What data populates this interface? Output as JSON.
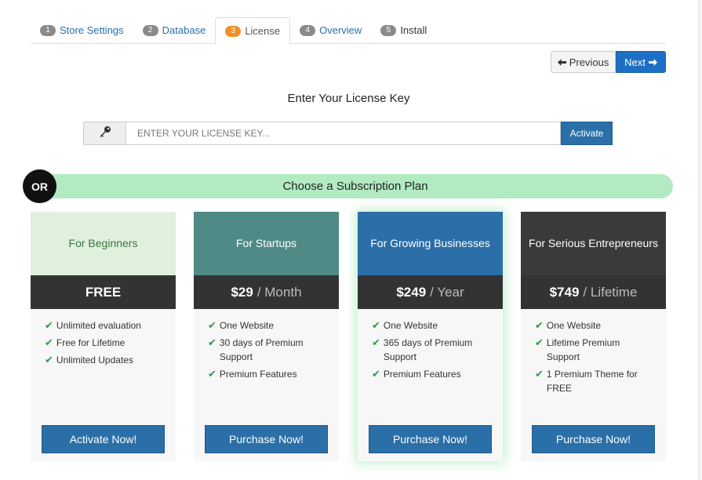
{
  "tabs": [
    {
      "num": "1",
      "label": "Store Settings"
    },
    {
      "num": "2",
      "label": "Database"
    },
    {
      "num": "3",
      "label": "License"
    },
    {
      "num": "4",
      "label": "Overview"
    },
    {
      "num": "5",
      "label": "Install"
    }
  ],
  "pager": {
    "previous_label": "Previous",
    "next_label": "Next"
  },
  "license": {
    "title": "Enter Your License Key",
    "placeholder": "ENTER YOUR LICENSE KEY...",
    "value": "",
    "activate_label": "Activate"
  },
  "or_label": "OR",
  "subscription_title": "Choose a Subscription Plan",
  "plans": [
    {
      "title": "For Beginners",
      "price": "FREE",
      "period": "",
      "features": [
        "Unlimited evaluation",
        "Free for Lifetime",
        "Unlimited Updates"
      ],
      "button": "Activate Now!",
      "header_color": "#dff0dd",
      "header_text_color": "#3c763d"
    },
    {
      "title": "For Startups",
      "price": "$29",
      "period": "/ Month",
      "features": [
        "One Website",
        "30 days of Premium Support",
        "Premium Features"
      ],
      "button": "Purchase Now!",
      "header_color": "#4f8a87",
      "header_text_color": "#ffffff"
    },
    {
      "title": "For Growing Businesses",
      "price": "$249",
      "period": "/ Year",
      "features": [
        "One Website",
        "365 days of Premium Support",
        "Premium Features"
      ],
      "button": "Purchase Now!",
      "header_color": "#2b6ea8",
      "header_text_color": "#ffffff"
    },
    {
      "title": "For Serious Entrepreneurs",
      "price": "$749",
      "period": "/ Lifetime",
      "features": [
        "One Website",
        "Lifetime Premium Support",
        "1 Premium Theme for FREE"
      ],
      "button": "Purchase Now!",
      "header_color": "#333333",
      "header_text_color": "#ffffff"
    }
  ],
  "icons": {
    "key": "key-icon",
    "check": "check-icon",
    "arrow_left": "arrow-left-icon",
    "arrow_right": "arrow-right-icon"
  },
  "colors": {
    "accent": "#2a6fa8",
    "active_step": "#f0902a",
    "or_banner": "#b2ebc2",
    "check": "#2e9a44"
  }
}
